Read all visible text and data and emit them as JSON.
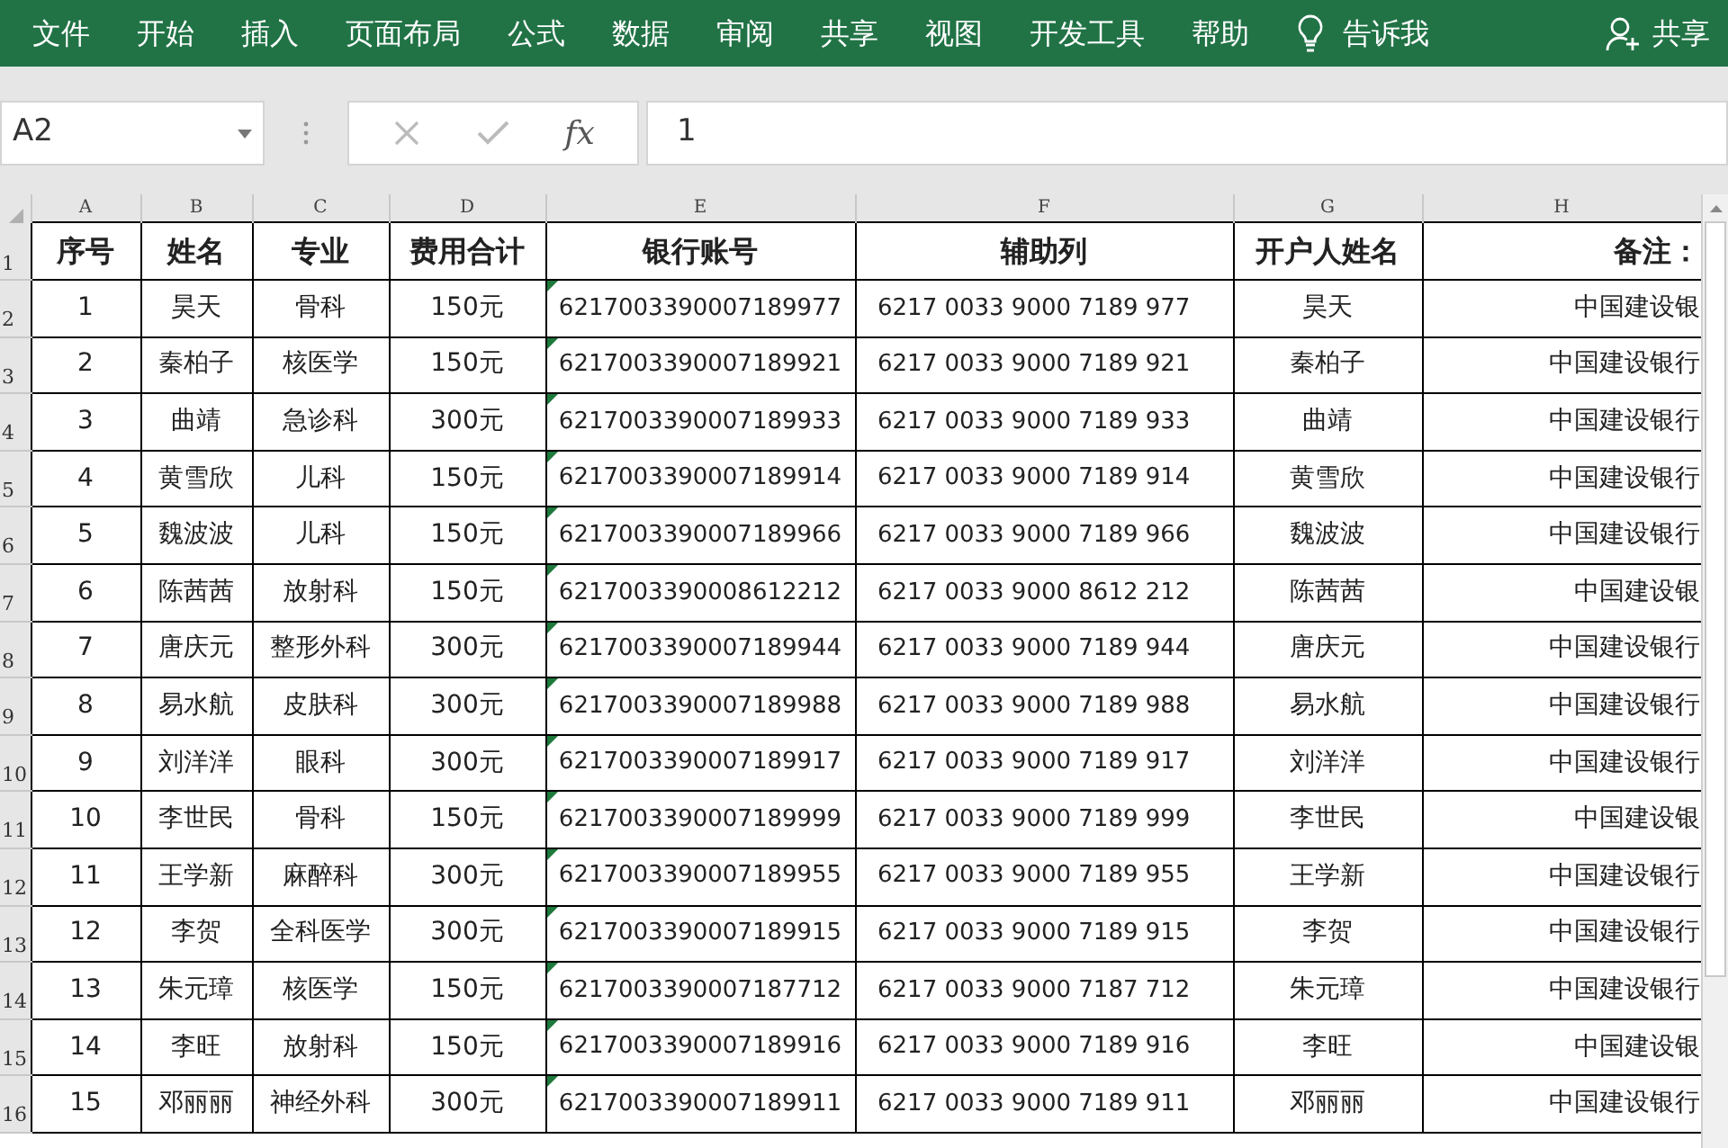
{
  "ribbon": {
    "tabs": [
      "文件",
      "开始",
      "插入",
      "页面布局",
      "公式",
      "数据",
      "审阅",
      "共享",
      "视图",
      "开发工具",
      "帮助"
    ],
    "tell_me": "告诉我",
    "share": "共享"
  },
  "formula_bar": {
    "name_box": "A2",
    "fx": "fx",
    "value": "1"
  },
  "sheet": {
    "column_letters": [
      "A",
      "B",
      "C",
      "D",
      "E",
      "F",
      "G",
      "H"
    ],
    "header": [
      "序号",
      "姓名",
      "专业",
      "费用合计",
      "银行账号",
      "辅助列",
      "开户人姓名",
      "备注："
    ],
    "rows": [
      {
        "n": "2",
        "cells": [
          "1",
          "昊天",
          "骨科",
          "150元",
          "6217003390007189977",
          "6217 0033 9000 7189 977",
          "昊天",
          "中国建设银"
        ],
        "warning": true
      },
      {
        "n": "3",
        "cells": [
          "2",
          "秦柏子",
          "核医学",
          "150元",
          "6217003390007189921",
          "6217 0033 9000 7189 921",
          "秦柏子",
          "中国建设银行"
        ],
        "warning": true
      },
      {
        "n": "4",
        "cells": [
          "3",
          "曲靖",
          "急诊科",
          "300元",
          "6217003390007189933",
          "6217 0033 9000 7189 933",
          "曲靖",
          "中国建设银行"
        ],
        "warning": true
      },
      {
        "n": "5",
        "cells": [
          "4",
          "黄雪欣",
          "儿科",
          "150元",
          "6217003390007189914",
          "6217 0033 9000 7189 914",
          "黄雪欣",
          "中国建设银行"
        ],
        "warning": true
      },
      {
        "n": "6",
        "cells": [
          "5",
          "魏波波",
          "儿科",
          "150元",
          "6217003390007189966",
          "6217 0033 9000 7189 966",
          "魏波波",
          "中国建设银行"
        ],
        "warning": true
      },
      {
        "n": "7",
        "cells": [
          "6",
          "陈茜茜",
          "放射科",
          "150元",
          "6217003390008612212",
          "6217 0033 9000 8612 212",
          "陈茜茜",
          "中国建设银"
        ],
        "warning": true
      },
      {
        "n": "8",
        "cells": [
          "7",
          "唐庆元",
          "整形外科",
          "300元",
          "6217003390007189944",
          "6217 0033 9000 7189 944",
          "唐庆元",
          "中国建设银行"
        ],
        "warning": true
      },
      {
        "n": "9",
        "cells": [
          "8",
          "易水航",
          "皮肤科",
          "300元",
          "6217003390007189988",
          "6217 0033 9000 7189 988",
          "易水航",
          "中国建设银行"
        ],
        "warning": true
      },
      {
        "n": "10",
        "cells": [
          "9",
          "刘洋洋",
          "眼科",
          "300元",
          "6217003390007189917",
          "6217 0033 9000 7189 917",
          "刘洋洋",
          "中国建设银行"
        ],
        "warning": true
      },
      {
        "n": "11",
        "cells": [
          "10",
          "李世民",
          "骨科",
          "150元",
          "6217003390007189999",
          "6217 0033 9000 7189 999",
          "李世民",
          "中国建设银"
        ],
        "warning": true
      },
      {
        "n": "12",
        "cells": [
          "11",
          "王学新",
          "麻醉科",
          "300元",
          "6217003390007189955",
          "6217 0033 9000 7189 955",
          "王学新",
          "中国建设银行"
        ],
        "warning": true
      },
      {
        "n": "13",
        "cells": [
          "12",
          "李贺",
          "全科医学",
          "300元",
          "6217003390007189915",
          "6217 0033 9000 7189 915",
          "李贺",
          "中国建设银行"
        ],
        "warning": true
      },
      {
        "n": "14",
        "cells": [
          "13",
          "朱元璋",
          "核医学",
          "150元",
          "6217003390007187712",
          "6217 0033 9000 7187 712",
          "朱元璋",
          "中国建设银行"
        ],
        "warning": true
      },
      {
        "n": "15",
        "cells": [
          "14",
          "李旺",
          "放射科",
          "150元",
          "6217003390007189916",
          "6217 0033 9000 7189 916",
          "李旺",
          "中国建设银"
        ],
        "warning": true
      },
      {
        "n": "16",
        "cells": [
          "15",
          "邓丽丽",
          "神经外科",
          "300元",
          "6217003390007189911",
          "6217 0033 9000 7189 911",
          "邓丽丽",
          "中国建设银行"
        ],
        "warning": true
      }
    ],
    "header_row_number": "1"
  }
}
